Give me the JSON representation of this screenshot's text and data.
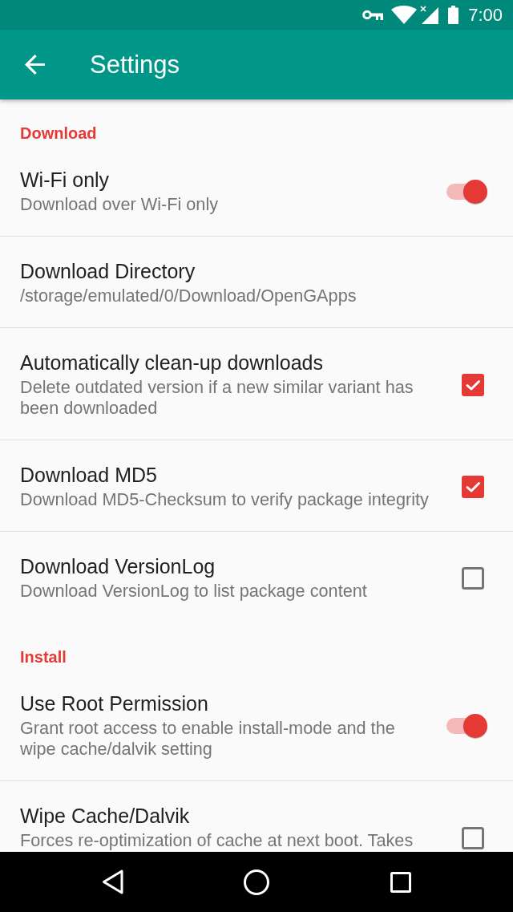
{
  "status_bar": {
    "time": "7:00"
  },
  "app_bar": {
    "title": "Settings"
  },
  "sections": [
    {
      "title": "Download",
      "items": [
        {
          "kind": "switch",
          "title": "Wi-Fi only",
          "summary": "Download over Wi-Fi only",
          "on": true
        },
        {
          "kind": "plain",
          "title": "Download Directory",
          "summary": "/storage/emulated/0/Download/OpenGApps"
        },
        {
          "kind": "checkbox",
          "title": "Automatically clean-up downloads",
          "summary": "Delete outdated version if a new similar variant has been downloaded",
          "checked": true
        },
        {
          "kind": "checkbox",
          "title": "Download MD5",
          "summary": "Download MD5-Checksum to verify package integrity",
          "checked": true
        },
        {
          "kind": "checkbox",
          "title": "Download VersionLog",
          "summary": "Download VersionLog to list package content",
          "checked": false
        }
      ]
    },
    {
      "title": "Install",
      "items": [
        {
          "kind": "switch",
          "title": "Use Root Permission",
          "summary": "Grant root access to enable install-mode and the wipe cache/dalvik setting",
          "on": true
        },
        {
          "kind": "checkbox",
          "title": "Wipe Cache/Dalvik",
          "summary": "Forces re-optimization of cache at next boot. Takes",
          "checked": false
        }
      ]
    }
  ]
}
